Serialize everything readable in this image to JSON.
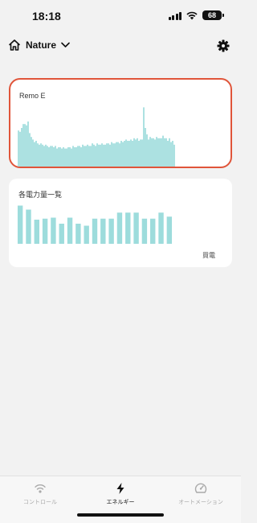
{
  "status_bar": {
    "time": "18:18",
    "battery": "68"
  },
  "header": {
    "home_title": "Nature"
  },
  "remo_card": {
    "title": "Remo E",
    "chart_data": {
      "type": "bar",
      "series": [
        {
          "values": [
            28,
            27,
            30,
            33,
            33,
            32,
            35,
            26,
            23,
            21,
            19,
            20,
            18,
            17,
            18,
            17,
            16,
            17,
            16,
            15,
            16,
            16,
            15,
            16,
            14,
            15,
            15,
            14,
            15,
            14,
            14,
            15,
            15,
            14,
            16,
            15,
            15,
            16,
            16,
            15,
            17,
            16,
            16,
            17,
            16,
            16,
            18,
            17,
            16,
            18,
            17,
            17,
            18,
            17,
            17,
            18,
            18,
            17,
            19,
            18,
            18,
            19,
            19,
            18,
            20,
            19,
            20,
            21,
            20,
            20,
            21,
            20,
            22,
            21,
            22,
            20,
            21,
            21,
            46,
            30,
            25,
            21,
            23,
            22,
            22,
            21,
            23,
            22,
            22,
            22,
            24,
            22,
            22,
            20,
            22,
            19,
            20,
            17
          ]
        }
      ],
      "color": "#9ddcdc",
      "ymax": 50
    }
  },
  "devices_card": {
    "title": "各電力量一覧",
    "legend_buy": "買電",
    "chart_data": {
      "type": "bar",
      "series": [
        {
          "values": [
            38,
            34,
            24,
            25,
            26,
            20,
            26,
            20,
            18,
            25,
            25,
            25,
            31,
            31,
            31,
            25,
            25,
            31,
            27
          ]
        }
      ],
      "color": "#9ddcdc",
      "ymax": 40
    }
  },
  "tabbar": {
    "tabs": [
      {
        "label": "コントロール"
      },
      {
        "label": "エネルギー"
      },
      {
        "label": "オートメーション"
      }
    ]
  },
  "icons": {
    "signal": "cellular-signal-icon",
    "wifi": "wifi-icon",
    "home": "home-icon",
    "chevron": "chevron-down-icon",
    "settings": "gear-icon",
    "control": "wireless-signal-icon",
    "energy": "lightning-bolt-icon",
    "automation": "automation-gauge-icon"
  }
}
